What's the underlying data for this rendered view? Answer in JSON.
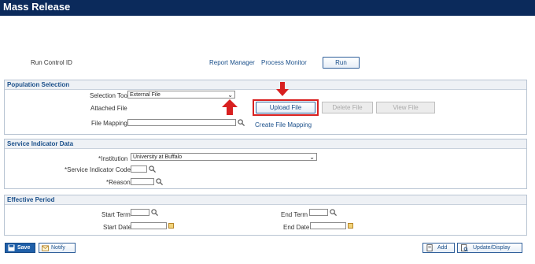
{
  "page": {
    "title": "Mass Release"
  },
  "run_bar": {
    "run_control_label": "Run Control ID",
    "report_manager": "Report Manager",
    "process_monitor": "Process Monitor",
    "run_button": "Run"
  },
  "population": {
    "heading": "Population Selection",
    "selection_tool_label": "Selection Tool",
    "selection_tool_value": "External File",
    "attached_file_label": "Attached File",
    "upload_button": "Upload File",
    "delete_button": "Delete File",
    "view_button": "View File",
    "file_mapping_label": "File Mapping",
    "file_mapping_value": "",
    "create_mapping_link": "Create File Mapping"
  },
  "service_indicator": {
    "heading": "Service Indicator Data",
    "institution_label": "*Institution",
    "institution_value": "University at Buffalo",
    "code_label": "*Service Indicator Code",
    "code_value": "",
    "reason_label": "*Reason",
    "reason_value": ""
  },
  "effective_period": {
    "heading": "Effective Period",
    "start_term_label": "Start Term",
    "end_term_label": "End Term",
    "start_date_label": "Start Date",
    "end_date_label": "End Date"
  },
  "footer": {
    "save": "Save",
    "notify": "Notify",
    "add": "Add",
    "update_display": "Update/Display"
  },
  "colors": {
    "title_bar": "#0b2a5b",
    "link": "#1a4f8a",
    "highlight": "#d82020",
    "save_button": "#1f5fa8"
  }
}
